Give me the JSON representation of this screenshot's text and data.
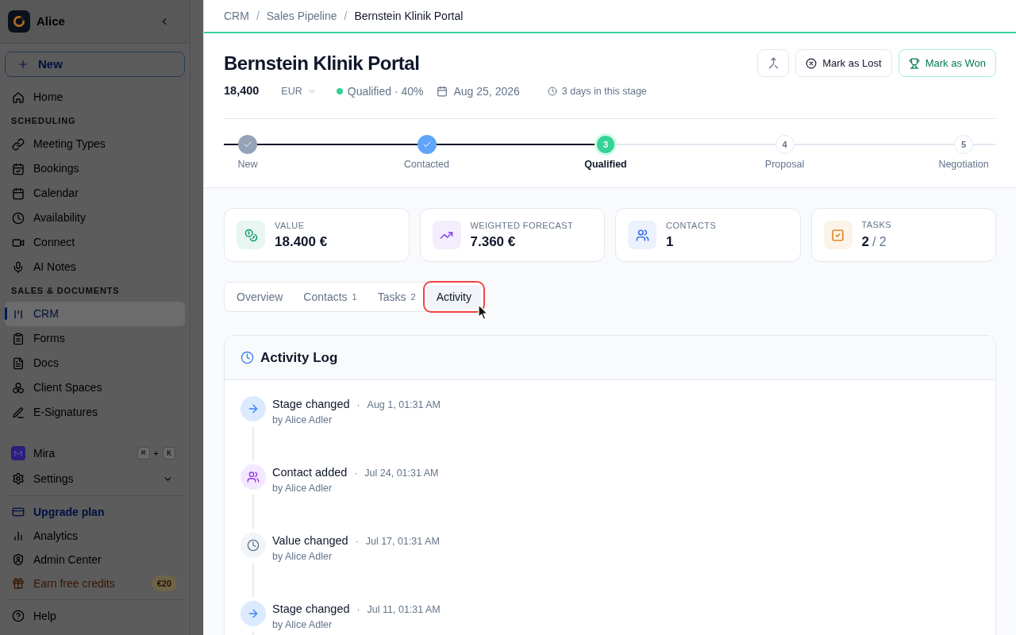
{
  "sidebar": {
    "workspace": "Alice",
    "new_button": "New",
    "sections": [
      {
        "items": [
          {
            "label": "Home",
            "selected": false
          }
        ]
      },
      {
        "heading": "SCHEDULING",
        "items": [
          {
            "label": "Meeting Types",
            "selected": false
          },
          {
            "label": "Bookings",
            "selected": false
          },
          {
            "label": "Calendar",
            "selected": false
          },
          {
            "label": "Availability",
            "selected": false
          },
          {
            "label": "Connect",
            "selected": false
          },
          {
            "label": "AI Notes",
            "selected": false
          }
        ]
      },
      {
        "heading": "SALES & DOCUMENTS",
        "items": [
          {
            "label": "CRM",
            "selected": true
          },
          {
            "label": "Forms",
            "selected": false
          },
          {
            "label": "Docs",
            "selected": false
          },
          {
            "label": "Client Spaces",
            "selected": false
          },
          {
            "label": "E-Signatures",
            "selected": false
          }
        ]
      }
    ],
    "assistant": {
      "label": "Mira",
      "shortcut": {
        "keys": [
          "⌘",
          "K"
        ],
        "separator": "+"
      }
    },
    "settings": {
      "label": "Settings",
      "expanded": false
    },
    "footer_items": [
      {
        "label": "Upgrade plan",
        "kind": "upgrade",
        "selected": false
      },
      {
        "label": "Analytics",
        "kind": "plain",
        "selected": false
      },
      {
        "label": "Admin Center",
        "kind": "plain",
        "selected": false
      },
      {
        "label": "Earn free credits",
        "kind": "promo",
        "badge": "€20",
        "selected": false
      }
    ],
    "help": {
      "label": "Help"
    }
  },
  "breadcrumb": [
    {
      "label": "CRM",
      "current": false
    },
    {
      "separator": "/",
      "label": "Sales Pipeline",
      "current": false
    },
    {
      "separator": "/",
      "label": "Bernstein Klinik Portal",
      "current": true
    }
  ],
  "deal": {
    "title": "Bernstein Klinik Portal",
    "amount": "18,400",
    "currency": "EUR",
    "stage_label": "Qualified · 40%",
    "close_date": "Aug 25, 2026",
    "time_in_stage": "3 days in this stage"
  },
  "actions": [
    {
      "kind": "icon"
    },
    {
      "kind": "lost",
      "label": "Mark as Lost"
    },
    {
      "kind": "won",
      "label": "Mark as Won"
    }
  ],
  "pipeline": [
    {
      "label": "New",
      "completed": true,
      "current": false,
      "color": "#94a3b8"
    },
    {
      "label": "Contacted",
      "completed": true,
      "current": false,
      "color": "#60a5fa"
    },
    {
      "label": "Qualified",
      "number": "3",
      "completed": false,
      "current": true,
      "color": "#34d399"
    },
    {
      "label": "Proposal",
      "number": "4",
      "completed": false,
      "current": false
    },
    {
      "label": "Negotiation",
      "number": "5",
      "completed": false,
      "current": false
    }
  ],
  "stats": [
    {
      "label": "VALUE",
      "value": "18.400 €",
      "color": "#059669"
    },
    {
      "label": "WEIGHTED FORECAST",
      "value": "7.360 €",
      "color": "#7c3aed"
    },
    {
      "label": "CONTACTS",
      "value": "1",
      "color": "#2563eb"
    },
    {
      "label": "TASKS",
      "value": "2",
      "total": "/ 2",
      "color": "#d97706"
    }
  ],
  "tabs": [
    {
      "label": "Overview",
      "selected": false,
      "highlighted": false
    },
    {
      "label": "Contacts",
      "count": "1",
      "selected": false,
      "highlighted": false
    },
    {
      "label": "Tasks",
      "count": "2",
      "selected": false,
      "highlighted": false
    },
    {
      "label": "Activity",
      "selected": true,
      "highlighted": true
    }
  ],
  "activity": {
    "title": "Activity Log",
    "entries": [
      {
        "kind": "stage",
        "title": "Stage changed",
        "dot": "·",
        "time": "Aug 1, 01:31 AM",
        "author": "by Alice Adler"
      },
      {
        "kind": "contact",
        "title": "Contact added",
        "dot": "·",
        "time": "Jul 24, 01:31 AM",
        "author": "by Alice Adler"
      },
      {
        "kind": "value",
        "title": "Value changed",
        "dot": "·",
        "time": "Jul 17, 01:31 AM",
        "author": "by Alice Adler"
      },
      {
        "kind": "stage",
        "title": "Stage changed",
        "dot": "·",
        "time": "Jul 11, 01:31 AM",
        "author": "by Alice Adler"
      }
    ]
  }
}
